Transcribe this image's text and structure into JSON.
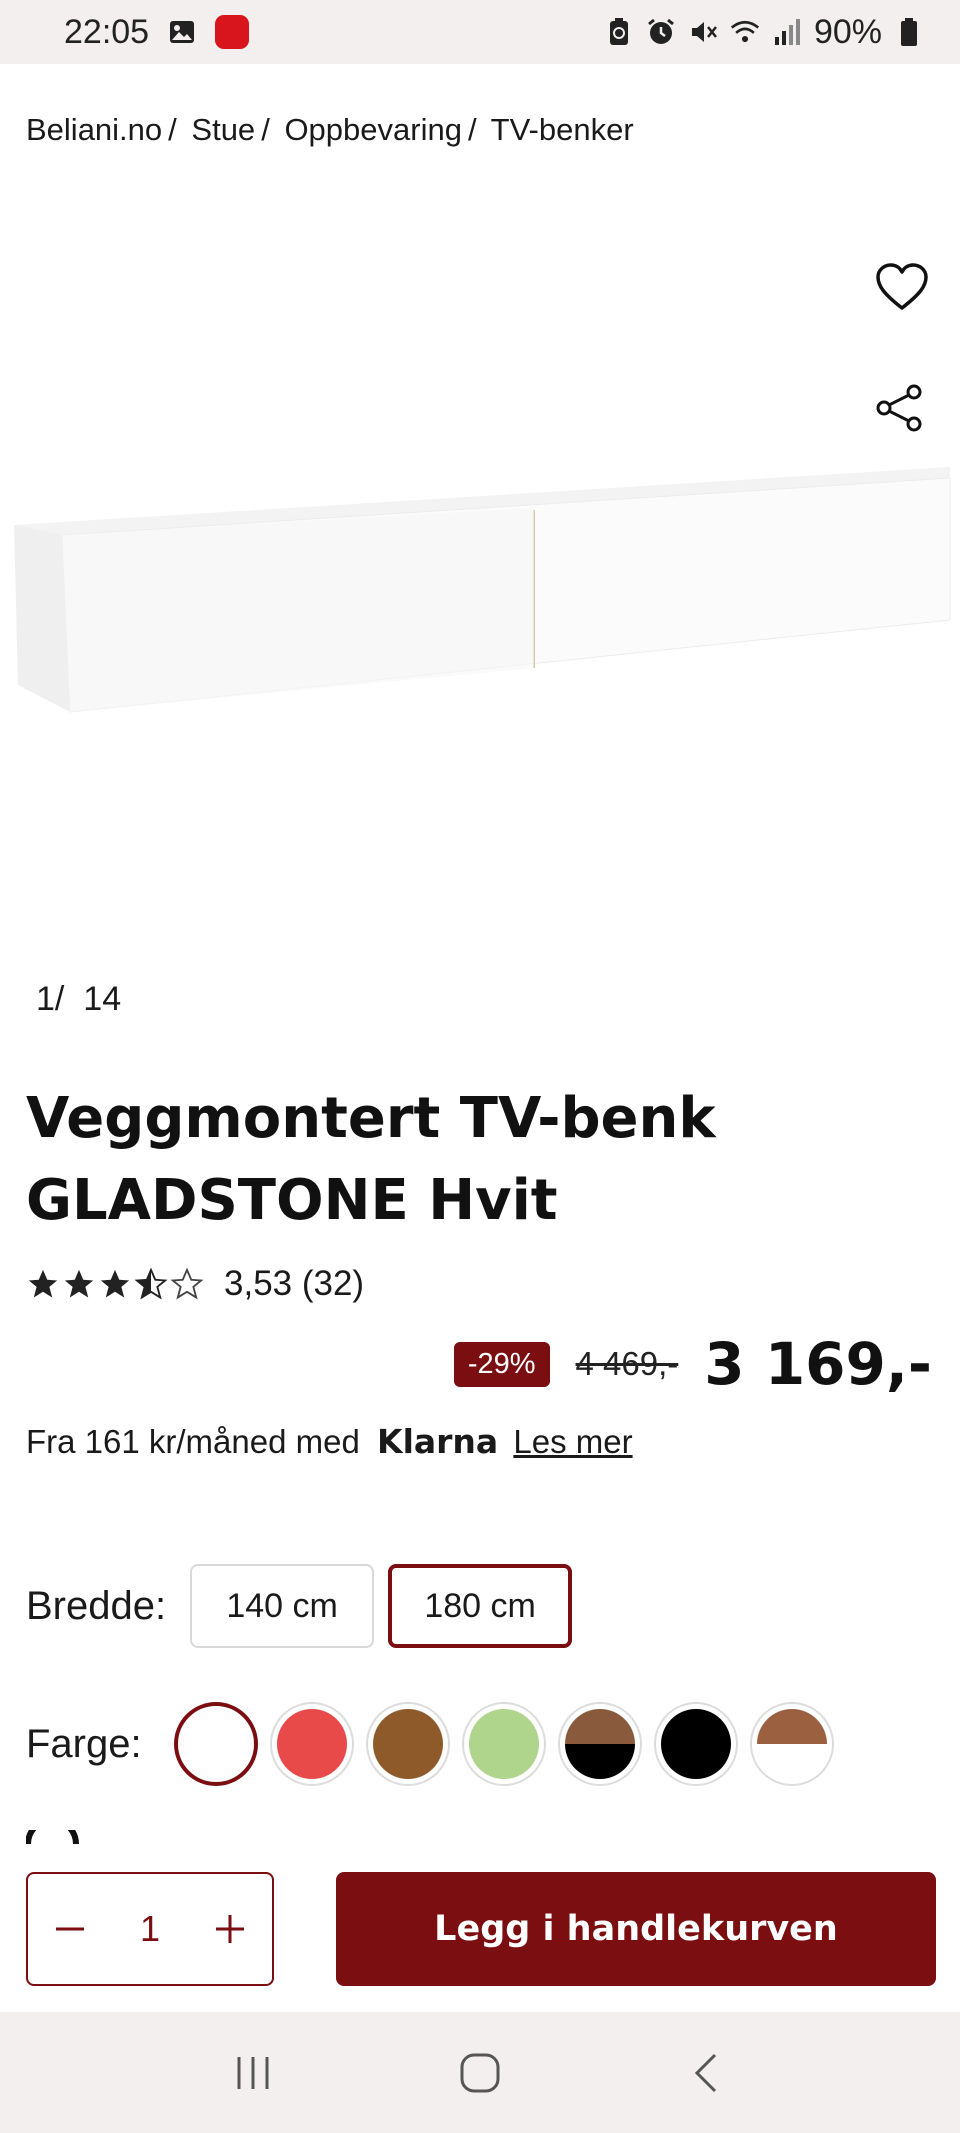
{
  "status_bar": {
    "time": "22:05",
    "battery": "90%"
  },
  "breadcrumb": [
    "Beliani.no",
    "Stue",
    "Oppbevaring",
    "TV-benker"
  ],
  "breadcrumb_separator": "/",
  "gallery": {
    "counter_current": "1",
    "counter_sep": "/",
    "counter_total": "14"
  },
  "product": {
    "title_line1": "Veggmontert TV-benk",
    "title_line2": "GLADSTONE Hvit",
    "rating_value": 3.53,
    "rating_text": "3,53 (32)",
    "discount": "-29%",
    "old_price": "4 469,-",
    "price": "3 169,-"
  },
  "klarna": {
    "prefix": "Fra 161 kr/måned med",
    "brand": "Klarna",
    "link": "Les mer"
  },
  "width": {
    "label": "Bredde:",
    "options": [
      "140 cm",
      "180 cm"
    ],
    "selected": "180 cm"
  },
  "color": {
    "label": "Farge:",
    "swatches": [
      {
        "name": "white",
        "colors": [
          "#ffffff"
        ],
        "selected": true
      },
      {
        "name": "red",
        "colors": [
          "#e84a4a"
        ]
      },
      {
        "name": "brown",
        "colors": [
          "#8e5a2a"
        ]
      },
      {
        "name": "green",
        "colors": [
          "#afd48c"
        ]
      },
      {
        "name": "brown-black",
        "colors": [
          "#8a5a3c",
          "#000000"
        ]
      },
      {
        "name": "black",
        "colors": [
          "#000000"
        ]
      },
      {
        "name": "brown-white",
        "colors": [
          "#9a6040",
          "#ffffff"
        ]
      }
    ]
  },
  "cart": {
    "quantity": "1",
    "add_label": "Legg i handlekurven"
  },
  "colors": {
    "accent": "#7a0e10",
    "status_bar_bg": "#f2efee"
  }
}
